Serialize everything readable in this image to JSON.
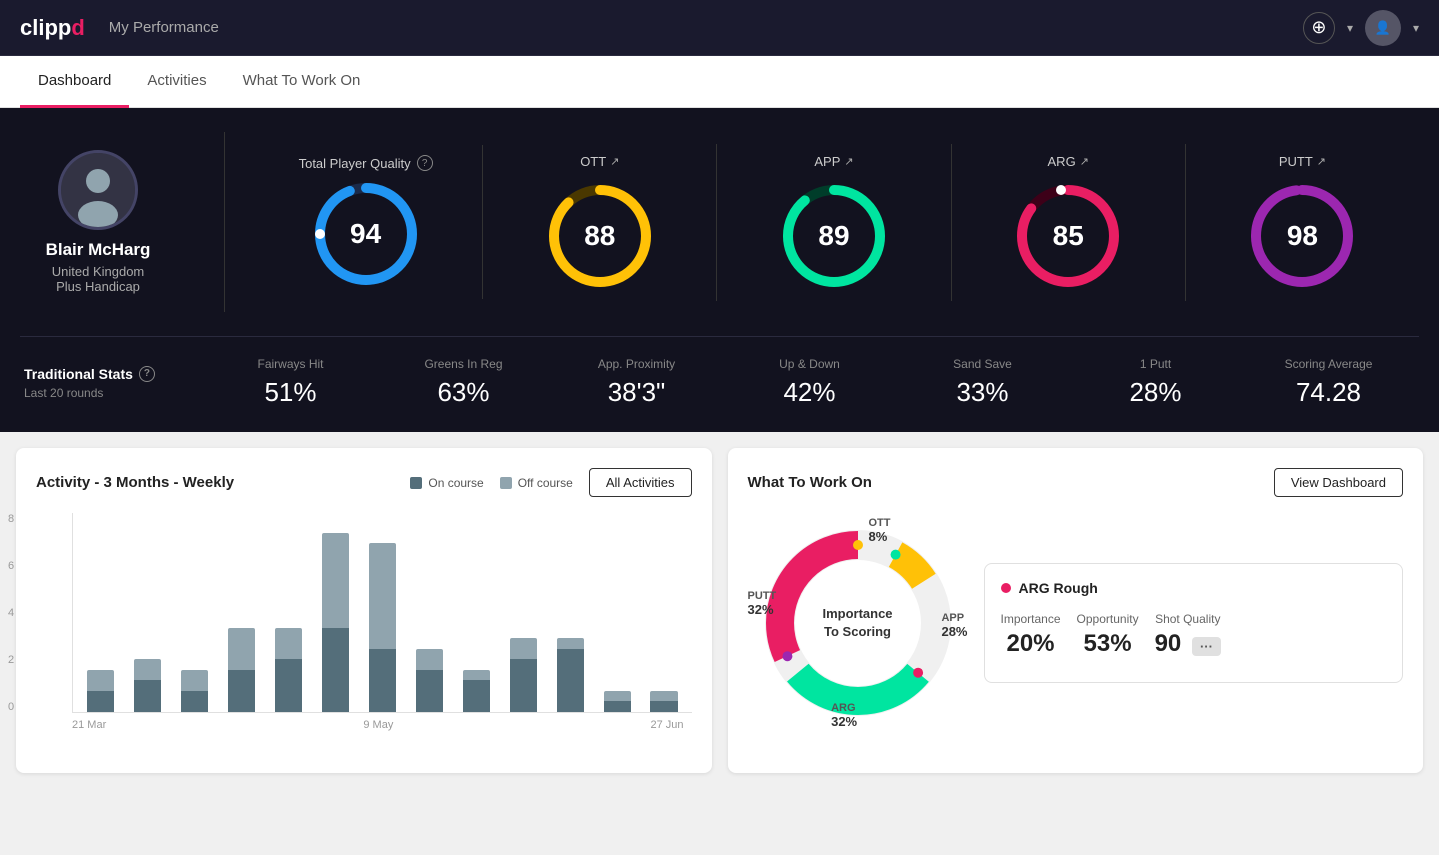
{
  "header": {
    "logo": "clippd",
    "title": "My Performance"
  },
  "tabs": [
    {
      "id": "dashboard",
      "label": "Dashboard",
      "active": true
    },
    {
      "id": "activities",
      "label": "Activities",
      "active": false
    },
    {
      "id": "what-to-work-on",
      "label": "What To Work On",
      "active": false
    }
  ],
  "player": {
    "name": "Blair McHarg",
    "country": "United Kingdom",
    "handicap": "Plus Handicap"
  },
  "totalQuality": {
    "label": "Total Player Quality",
    "value": 94,
    "color": "#2196f3"
  },
  "metrics": [
    {
      "id": "ott",
      "label": "OTT",
      "value": 88,
      "color": "#ffc107",
      "trackColor": "#4a3800"
    },
    {
      "id": "app",
      "label": "APP",
      "value": 89,
      "color": "#00e5a0",
      "trackColor": "#003d2a"
    },
    {
      "id": "arg",
      "label": "ARG",
      "value": 85,
      "color": "#e91e63",
      "trackColor": "#3d0018"
    },
    {
      "id": "putt",
      "label": "PUTT",
      "value": 98,
      "color": "#9c27b0",
      "trackColor": "#2d0038"
    }
  ],
  "traditionalStats": {
    "title": "Traditional Stats",
    "subtitle": "Last 20 rounds",
    "items": [
      {
        "label": "Fairways Hit",
        "value": "51%"
      },
      {
        "label": "Greens In Reg",
        "value": "63%"
      },
      {
        "label": "App. Proximity",
        "value": "38'3\""
      },
      {
        "label": "Up & Down",
        "value": "42%"
      },
      {
        "label": "Sand Save",
        "value": "33%"
      },
      {
        "label": "1 Putt",
        "value": "28%"
      },
      {
        "label": "Scoring Average",
        "value": "74.28"
      }
    ]
  },
  "activityChart": {
    "title": "Activity - 3 Months - Weekly",
    "legend": [
      {
        "label": "On course",
        "color": "#546e7a"
      },
      {
        "label": "Off course",
        "color": "#90a4ae"
      }
    ],
    "allActivitiesBtn": "All Activities",
    "yLabels": [
      "8",
      "6",
      "4",
      "2",
      "0"
    ],
    "xLabels": [
      "21 Mar",
      "9 May",
      "27 Jun"
    ],
    "bars": [
      {
        "on": 1,
        "off": 1
      },
      {
        "on": 1.5,
        "off": 1
      },
      {
        "on": 1,
        "off": 1
      },
      {
        "on": 2,
        "off": 2
      },
      {
        "on": 2.5,
        "off": 1.5
      },
      {
        "on": 4,
        "off": 4.5
      },
      {
        "on": 3,
        "off": 5
      },
      {
        "on": 2,
        "off": 1
      },
      {
        "on": 1.5,
        "off": 0.5
      },
      {
        "on": 2.5,
        "off": 1
      },
      {
        "on": 3,
        "off": 0.5
      },
      {
        "on": 0.5,
        "off": 0.5
      },
      {
        "on": 0.5,
        "off": 0.5
      }
    ]
  },
  "workOn": {
    "title": "What To Work On",
    "viewDashboardBtn": "View Dashboard",
    "donut": {
      "center": "Importance\nTo Scoring",
      "segments": [
        {
          "id": "ott",
          "label": "OTT",
          "percent": 8,
          "color": "#ffc107",
          "labelPos": {
            "top": "4%",
            "left": "58%"
          }
        },
        {
          "id": "app",
          "label": "APP",
          "percent": 28,
          "color": "#00e5a0",
          "labelPos": {
            "top": "50%",
            "right": "2%"
          }
        },
        {
          "id": "arg",
          "label": "ARG",
          "percent": 32,
          "color": "#e91e63",
          "labelPos": {
            "bottom": "4%",
            "left": "40%"
          }
        },
        {
          "id": "putt",
          "label": "PUTT",
          "percent": 32,
          "color": "#9c27b0",
          "labelPos": {
            "top": "38%",
            "left": "2%"
          }
        }
      ]
    },
    "highlight": {
      "title": "ARG Rough",
      "dotColor": "#e91e63",
      "metrics": [
        {
          "label": "Importance",
          "value": "20%"
        },
        {
          "label": "Opportunity",
          "value": "53%"
        },
        {
          "label": "Shot Quality",
          "value": "90"
        }
      ]
    }
  }
}
